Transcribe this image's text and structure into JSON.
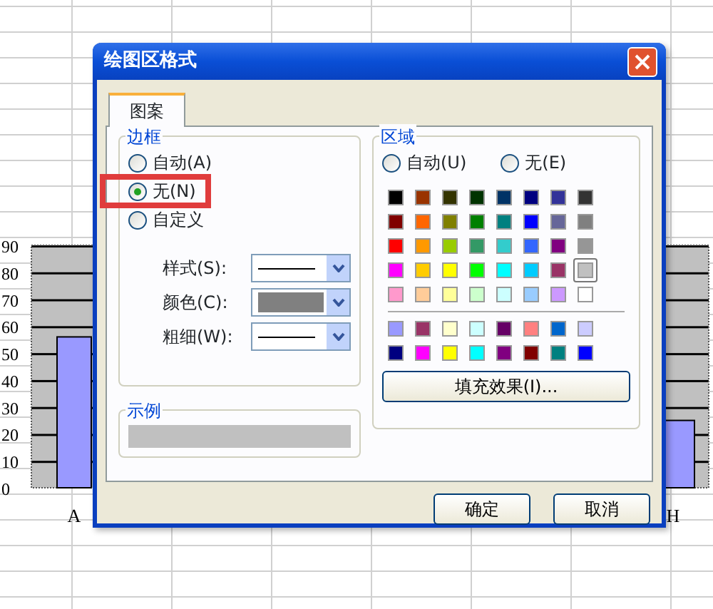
{
  "window": {
    "title": "绘图区格式"
  },
  "tabs": [
    {
      "label": "图案",
      "selected": true
    }
  ],
  "border": {
    "title": "边框",
    "options": [
      {
        "label": "自动(A)",
        "selected": false
      },
      {
        "label": "无(N)",
        "selected": true
      },
      {
        "label": "自定义",
        "selected": false
      }
    ],
    "fields": [
      {
        "label": "样式(S):",
        "kind": "line"
      },
      {
        "label": "颜色(C):",
        "kind": "swatch",
        "color": "#808080"
      },
      {
        "label": "粗细(W):",
        "kind": "line"
      }
    ]
  },
  "sample": {
    "title": "示例"
  },
  "area": {
    "title": "区域",
    "options": [
      {
        "label": "自动(U)",
        "selected": false
      },
      {
        "label": "无(E)",
        "selected": false
      }
    ],
    "palette": [
      [
        {
          "color": "#000000",
          "selected": false
        },
        {
          "color": "#993300",
          "selected": false
        },
        {
          "color": "#333300",
          "selected": false
        },
        {
          "color": "#003300",
          "selected": false
        },
        {
          "color": "#003366",
          "selected": false
        },
        {
          "color": "#000080",
          "selected": false
        },
        {
          "color": "#333399",
          "selected": false
        },
        {
          "color": "#333333",
          "selected": false
        }
      ],
      [
        {
          "color": "#800000",
          "selected": false
        },
        {
          "color": "#ff6600",
          "selected": false
        },
        {
          "color": "#808000",
          "selected": false
        },
        {
          "color": "#008000",
          "selected": false
        },
        {
          "color": "#008080",
          "selected": false
        },
        {
          "color": "#0000ff",
          "selected": false
        },
        {
          "color": "#666699",
          "selected": false
        },
        {
          "color": "#808080",
          "selected": false
        }
      ],
      [
        {
          "color": "#ff0000",
          "selected": false
        },
        {
          "color": "#ff9900",
          "selected": false
        },
        {
          "color": "#99cc00",
          "selected": false
        },
        {
          "color": "#339966",
          "selected": false
        },
        {
          "color": "#33cccc",
          "selected": false
        },
        {
          "color": "#3366ff",
          "selected": false
        },
        {
          "color": "#800080",
          "selected": false
        },
        {
          "color": "#969696",
          "selected": false
        }
      ],
      [
        {
          "color": "#ff00ff",
          "selected": false
        },
        {
          "color": "#ffcc00",
          "selected": false
        },
        {
          "color": "#ffff00",
          "selected": false
        },
        {
          "color": "#00ff00",
          "selected": false
        },
        {
          "color": "#00ffff",
          "selected": false
        },
        {
          "color": "#00ccff",
          "selected": false
        },
        {
          "color": "#993366",
          "selected": false
        },
        {
          "color": "#c0c0c0",
          "selected": true
        }
      ],
      [
        {
          "color": "#ff99cc",
          "selected": false
        },
        {
          "color": "#ffcc99",
          "selected": false
        },
        {
          "color": "#ffff99",
          "selected": false
        },
        {
          "color": "#ccffcc",
          "selected": false
        },
        {
          "color": "#ccffff",
          "selected": false
        },
        {
          "color": "#99ccff",
          "selected": false
        },
        {
          "color": "#cc99ff",
          "selected": false
        },
        {
          "color": "#ffffff",
          "selected": false
        }
      ]
    ],
    "extra_palette": [
      [
        {
          "color": "#9999ff",
          "selected": false
        },
        {
          "color": "#993366",
          "selected": false
        },
        {
          "color": "#ffffcc",
          "selected": false
        },
        {
          "color": "#ccffff",
          "selected": false
        },
        {
          "color": "#660066",
          "selected": false
        },
        {
          "color": "#ff8080",
          "selected": false
        },
        {
          "color": "#0066cc",
          "selected": false
        },
        {
          "color": "#ccccff",
          "selected": false
        }
      ],
      [
        {
          "color": "#000080",
          "selected": false
        },
        {
          "color": "#ff00ff",
          "selected": false
        },
        {
          "color": "#ffff00",
          "selected": false
        },
        {
          "color": "#00ffff",
          "selected": false
        },
        {
          "color": "#800080",
          "selected": false
        },
        {
          "color": "#800000",
          "selected": false
        },
        {
          "color": "#008080",
          "selected": false
        },
        {
          "color": "#0000ff",
          "selected": false
        }
      ]
    ],
    "button": "填充效果(I)..."
  },
  "buttons": [
    "确定",
    "取消"
  ],
  "chart_data": {
    "type": "bar",
    "categories": [
      "A",
      "H"
    ],
    "values": [
      56,
      25
    ],
    "ylim": [
      0,
      90
    ],
    "yticks": [
      0,
      10,
      20,
      30,
      40,
      50,
      60,
      70,
      80,
      90
    ]
  }
}
